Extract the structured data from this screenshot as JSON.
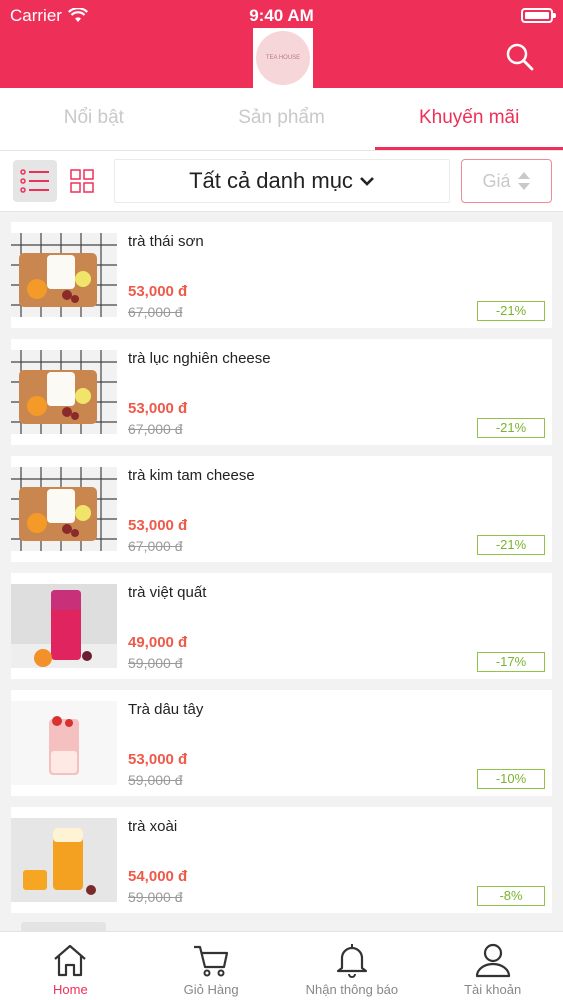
{
  "status_bar": {
    "carrier": "Carrier",
    "time": "9:40 AM"
  },
  "header": {
    "logo_text": "TEA HOUSE",
    "search_icon": "search-icon"
  },
  "tabs": [
    {
      "label": "Nổi bật",
      "active": false
    },
    {
      "label": "Sản phẩm",
      "active": false
    },
    {
      "label": "Khuyến mãi",
      "active": true
    }
  ],
  "filter": {
    "list_view_icon": "list-view-icon",
    "grid_view_icon": "grid-view-icon",
    "category_label": "Tất cả danh mục",
    "price_sort_label": "Giá"
  },
  "products": [
    {
      "name": "trà thái sơn",
      "price": "53,000 đ",
      "old_price": "67,000 đ",
      "discount": "-21%",
      "thumb": "tea-tray"
    },
    {
      "name": "trà lục nghiên cheese",
      "price": "53,000 đ",
      "old_price": "67,000 đ",
      "discount": "-21%",
      "thumb": "tea-tray"
    },
    {
      "name": "trà kim tam cheese",
      "price": "53,000 đ",
      "old_price": "67,000 đ",
      "discount": "-21%",
      "thumb": "tea-tray"
    },
    {
      "name": "trà việt quất",
      "price": "49,000 đ",
      "old_price": "59,000 đ",
      "discount": "-17%",
      "thumb": "blueberry"
    },
    {
      "name": "Trà dâu tây",
      "price": "53,000 đ",
      "old_price": "59,000 đ",
      "discount": "-10%",
      "thumb": "strawberry"
    },
    {
      "name": "trà xoài",
      "price": "54,000 đ",
      "old_price": "59,000 đ",
      "discount": "-8%",
      "thumb": "mango"
    }
  ],
  "bottom_nav": [
    {
      "label": "Home",
      "icon": "home-icon",
      "active": true
    },
    {
      "label": "Giỏ Hàng",
      "icon": "cart-icon",
      "active": false
    },
    {
      "label": "Nhận thông báo",
      "icon": "bell-icon",
      "active": false
    },
    {
      "label": "Tài khoản",
      "icon": "user-icon",
      "active": false
    }
  ],
  "colors": {
    "brand": "#ee3059",
    "price": "#ee5a4a",
    "discount": "#7ab32e"
  }
}
